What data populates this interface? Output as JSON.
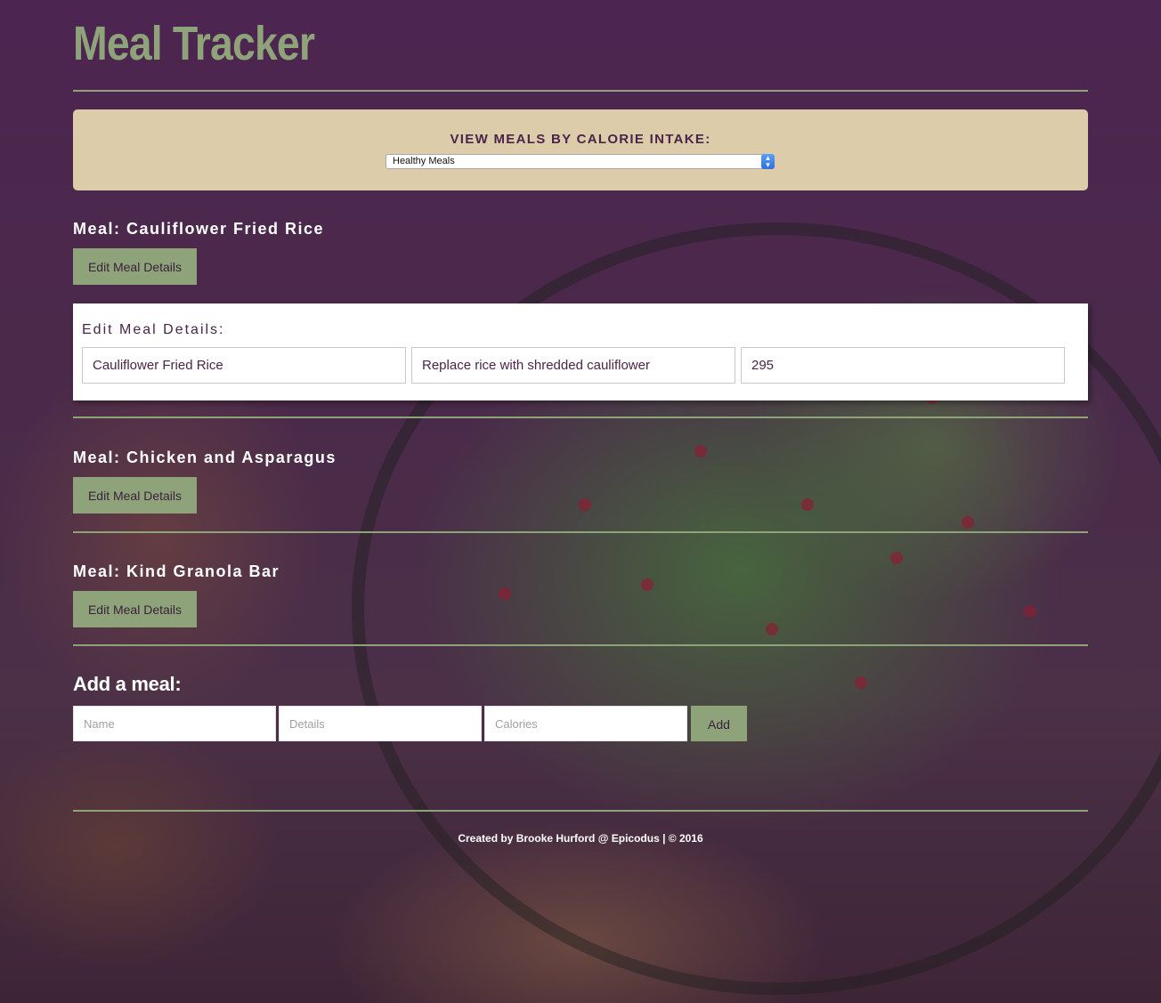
{
  "header": {
    "title": "Meal Tracker"
  },
  "filter": {
    "label": "VIEW MEALS BY CALORIE INTAKE:",
    "selected": "Healthy Meals"
  },
  "meals": [
    {
      "label": "Meal: Cauliflower Fried Rice",
      "edit_button": "Edit Meal Details"
    },
    {
      "label": "Meal: Chicken and Asparagus",
      "edit_button": "Edit Meal Details"
    },
    {
      "label": "Meal: Kind Granola Bar",
      "edit_button": "Edit Meal Details"
    }
  ],
  "edit_form": {
    "heading": "Edit Meal Details:",
    "name_value": "Cauliflower Fried Rice",
    "details_value": "Replace rice with shredded cauliflower",
    "calories_value": "295"
  },
  "add_form": {
    "heading": "Add a meal:",
    "name_placeholder": "Name",
    "details_placeholder": "Details",
    "calories_placeholder": "Calories",
    "submit_label": "Add"
  },
  "footer": {
    "text": "Created by Brooke Hurford @ Epicodus | © 2016"
  },
  "colors": {
    "accent_green": "#8fa37b",
    "panel_tan": "#dcccaa",
    "brand_purple": "#4a2449"
  },
  "icons": {
    "select_arrow": "select-updown-icon"
  }
}
